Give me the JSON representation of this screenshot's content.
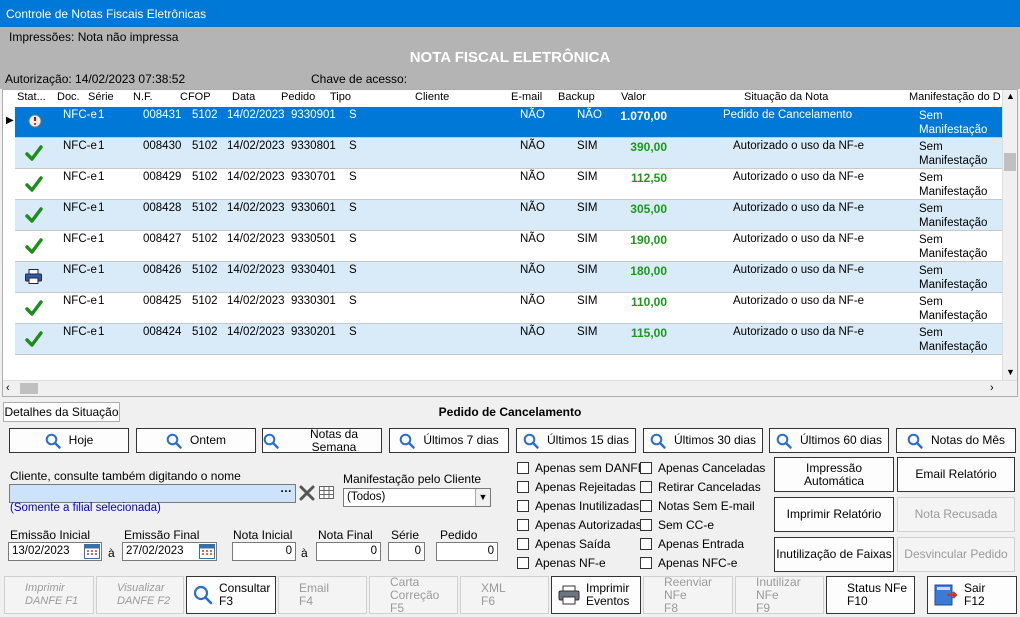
{
  "window": {
    "title": "Controle de Notas Fiscais Eletrônicas"
  },
  "header": {
    "print_status": "Impressões: Nota não impressa",
    "heading": "NOTA FISCAL ELETRÔNICA",
    "authorization": "Autorização: 14/02/2023 07:38:52",
    "access_key_label": "Chave de acesso:"
  },
  "grid": {
    "columns": [
      "Stat...",
      "Doc.",
      "Série",
      "N.F.",
      "CFOP",
      "Data",
      "Pedido",
      "Tipo",
      "Cliente",
      "E-mail",
      "Backup",
      "Valor",
      "Situação da Nota",
      "Manifestação do D"
    ],
    "rows": [
      {
        "status_icon": "cancel-request-icon",
        "doc": "NFC-e",
        "serie": "1",
        "nf": "008431",
        "cfop": "5102",
        "data": "14/02/2023",
        "pedido": "9330901",
        "tipo": "S",
        "email": "NÃO",
        "backup": "NÃO",
        "valor": "1.070,00",
        "situacao": "Pedido de Cancelamento",
        "man1": "Sem",
        "man2": "Manifestação"
      },
      {
        "status_icon": "check-icon",
        "doc": "NFC-e",
        "serie": "1",
        "nf": "008430",
        "cfop": "5102",
        "data": "14/02/2023",
        "pedido": "9330801",
        "tipo": "S",
        "email": "NÃO",
        "backup": "SIM",
        "valor": "390,00",
        "situacao": "Autorizado o uso da NF-e",
        "man1": "Sem",
        "man2": "Manifestação"
      },
      {
        "status_icon": "check-icon",
        "doc": "NFC-e",
        "serie": "1",
        "nf": "008429",
        "cfop": "5102",
        "data": "14/02/2023",
        "pedido": "9330701",
        "tipo": "S",
        "email": "NÃO",
        "backup": "SIM",
        "valor": "112,50",
        "situacao": "Autorizado o uso da NF-e",
        "man1": "Sem",
        "man2": "Manifestação"
      },
      {
        "status_icon": "check-icon",
        "doc": "NFC-e",
        "serie": "1",
        "nf": "008428",
        "cfop": "5102",
        "data": "14/02/2023",
        "pedido": "9330601",
        "tipo": "S",
        "email": "NÃO",
        "backup": "SIM",
        "valor": "305,00",
        "situacao": "Autorizado o uso da NF-e",
        "man1": "Sem",
        "man2": "Manifestação"
      },
      {
        "status_icon": "check-icon",
        "doc": "NFC-e",
        "serie": "1",
        "nf": "008427",
        "cfop": "5102",
        "data": "14/02/2023",
        "pedido": "9330501",
        "tipo": "S",
        "email": "NÃO",
        "backup": "SIM",
        "valor": "190,00",
        "situacao": "Autorizado o uso da NF-e",
        "man1": "Sem",
        "man2": "Manifestação"
      },
      {
        "status_icon": "printer-icon",
        "doc": "NFC-e",
        "serie": "1",
        "nf": "008426",
        "cfop": "5102",
        "data": "14/02/2023",
        "pedido": "9330401",
        "tipo": "S",
        "email": "NÃO",
        "backup": "SIM",
        "valor": "180,00",
        "situacao": "Autorizado o uso da NF-e",
        "man1": "Sem",
        "man2": "Manifestação"
      },
      {
        "status_icon": "check-icon",
        "doc": "NFC-e",
        "serie": "1",
        "nf": "008425",
        "cfop": "5102",
        "data": "14/02/2023",
        "pedido": "9330301",
        "tipo": "S",
        "email": "NÃO",
        "backup": "SIM",
        "valor": "110,00",
        "situacao": "Autorizado o uso da NF-e",
        "man1": "Sem",
        "man2": "Manifestação"
      },
      {
        "status_icon": "check-icon",
        "doc": "NFC-e",
        "serie": "1",
        "nf": "008424",
        "cfop": "5102",
        "data": "14/02/2023",
        "pedido": "9330201",
        "tipo": "S",
        "email": "NÃO",
        "backup": "SIM",
        "valor": "115,00",
        "situacao": "Autorizado o uso da NF-e",
        "man1": "Sem",
        "man2": "Manifestação"
      }
    ]
  },
  "details": {
    "button": "Detalhes da Situação",
    "status_text": "Pedido de Cancelamento"
  },
  "period_buttons": [
    "Hoje",
    "Ontem",
    "Notas da Semana",
    "Últimos 7 dias",
    "Últimos 15 dias",
    "Últimos 30 dias",
    "Últimos 60 dias",
    "Notas do Mês"
  ],
  "filters": {
    "client_label": "Cliente, consulte também digitando o nome",
    "client_value": "",
    "branch_note": "(Somente a filial selecionada)",
    "manifest_label": "Manifestação pelo Cliente",
    "manifest_value": "(Todos)",
    "emissao_inicial_label": "Emissão Inicial",
    "emissao_inicial": "13/02/2023",
    "emissao_final_label": "Emissão Final",
    "emissao_final": "27/02/2023",
    "a_label": "à",
    "nota_inicial_label": "Nota Inicial",
    "nota_inicial": "0",
    "nota_final_label": "Nota Final",
    "nota_final": "0",
    "serie_label": "Série",
    "serie": "0",
    "pedido_label": "Pedido",
    "pedido": "0",
    "dots": "···"
  },
  "checkboxes_left": [
    "Apenas sem DANFE",
    "Apenas Rejeitadas",
    "Apenas Inutilizadas",
    "Apenas Autorizadas",
    "Apenas Saída",
    "Apenas NF-e"
  ],
  "checkboxes_right": [
    "Apenas Canceladas",
    "Retirar Canceladas",
    "Notas Sem E-mail",
    "Sem CC-e",
    "Apenas Entrada",
    "Apenas NFC-e"
  ],
  "side_buttons": {
    "impressao_automatica": "Impressão Automática",
    "email_relatorio": "Email Relatório",
    "imprimir_relatorio": "Imprimir Relatório",
    "nota_recusada": "Nota Recusada",
    "inutilizacao": "Inutilização de Faixas",
    "desvincular": "Desvincular Pedido"
  },
  "toolbar": [
    {
      "l1": "Imprimir",
      "l2": "DANFE F1"
    },
    {
      "l1": "Visualizar",
      "l2": "DANFE F2"
    },
    {
      "l1": "Consultar",
      "l2": "F3"
    },
    {
      "l1": "Email",
      "l2": "F4"
    },
    {
      "l1": "Carta Correção",
      "l2": "F5"
    },
    {
      "l1": "XML",
      "l2": "F6"
    },
    {
      "l1": "Imprimir",
      "l2": "Eventos"
    },
    {
      "l1": "Reenviar NFe",
      "l2": "F8"
    },
    {
      "l1": "Inutilizar NFe",
      "l2": "F9"
    },
    {
      "l1": "Status NFe",
      "l2": "F10"
    },
    {
      "l1": "Sair",
      "l2": "F12"
    }
  ]
}
